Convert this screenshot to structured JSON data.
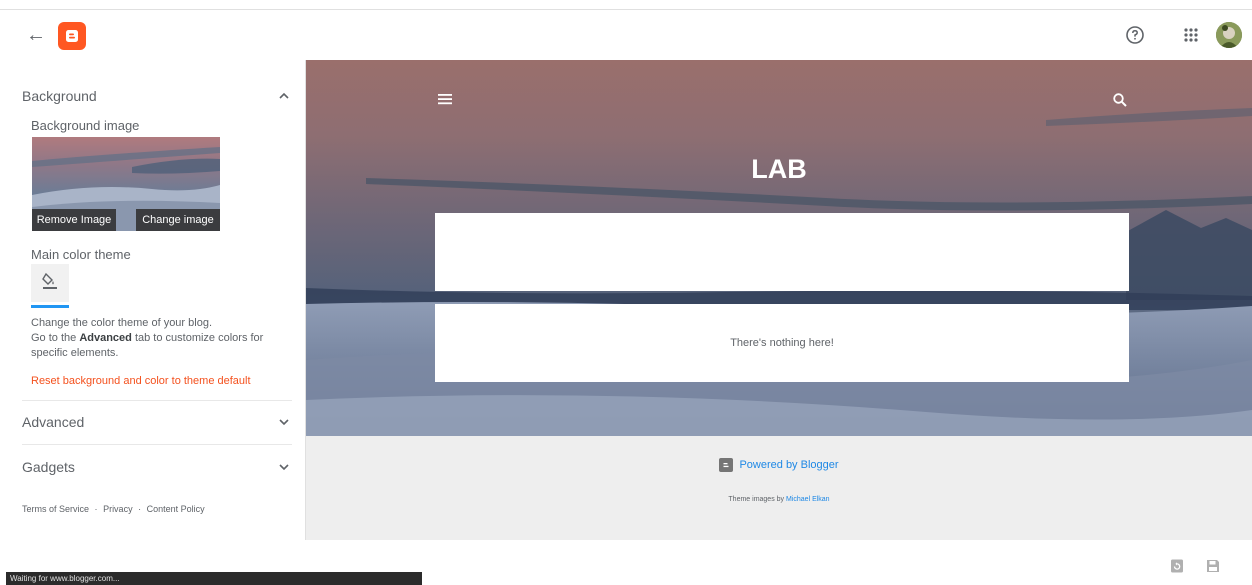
{
  "topbar": {
    "back_icon": "arrow-left-icon",
    "logo_icon": "blogger-logo-icon",
    "help_icon": "help-circle-icon",
    "apps_icon": "apps-grid-icon",
    "avatar_icon": "user-avatar"
  },
  "sidebar": {
    "background": {
      "title": "Background",
      "bg_image_label": "Background image",
      "remove_label": "Remove Image",
      "change_label": "Change image",
      "color_theme_label": "Main color theme",
      "desc_line1": "Change the color theme of your blog.",
      "desc_line2_pre": "Go to the ",
      "desc_line2_bold": "Advanced",
      "desc_line2_post": " tab to customize colors for specific elements.",
      "reset_label": "Reset background and color to theme default",
      "accent_color": "#2196f3",
      "reset_color": "#f4511e"
    },
    "advanced_title": "Advanced",
    "gadgets_title": "Gadgets",
    "footer": {
      "terms": "Terms of Service",
      "privacy": "Privacy",
      "content_policy": "Content Policy",
      "separator": "·"
    }
  },
  "preview": {
    "blog_title": "LAB",
    "empty_message": "There's nothing here!",
    "powered_by": "Powered by Blogger",
    "theme_credit_pre": "Theme images by ",
    "theme_credit_author": "Michael Elkan"
  },
  "bottom": {
    "status_text": "Waiting for www.blogger.com...",
    "revert_icon": "revert-icon",
    "save_icon": "save-icon"
  }
}
